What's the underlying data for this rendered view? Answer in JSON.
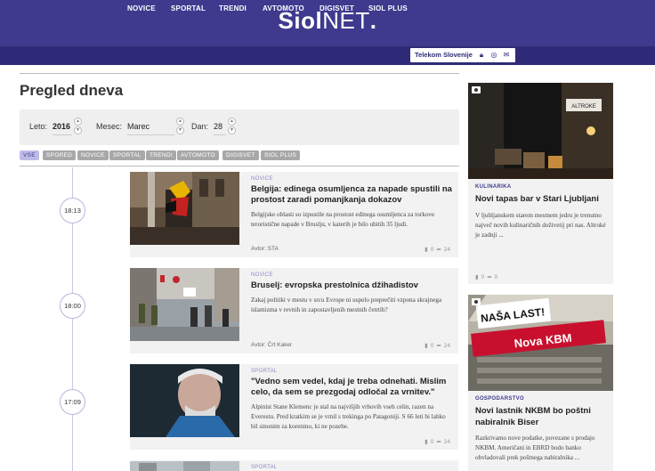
{
  "header": {
    "logo_bold": "Siol",
    "logo_light": "NET",
    "logo_dot": "."
  },
  "nav": {
    "items": [
      "NOVICE",
      "SPORTAL",
      "TRENDI",
      "AVTOMOTO",
      "DIGISVET",
      "SIOL PLUS"
    ],
    "telekom_label": "Telekom Slovenije"
  },
  "page": {
    "title": "Pregled dneva"
  },
  "filters": {
    "year_label": "Leto:",
    "year_value": "2016",
    "month_label": "Mesec:",
    "month_value": "Marec",
    "day_label": "Dan:",
    "day_value": "28"
  },
  "chips": [
    "VSE",
    "SPORED",
    "NOVICE",
    "SPORTAL",
    "TRENDI",
    "AVTOMOTO",
    "DIGISVET",
    "SIOL PLUS"
  ],
  "articles": [
    {
      "time": "18:13",
      "category": "NOVICE",
      "title": "Belgija: edinega osumljenca za napade spustili na prostost zaradi pomanjkanja dokazov",
      "excerpt": "Belgijske oblasti so izpustile na prostost edinega osumljenca za torkove teroristične napade v Bruslju, v katerih je bilo ubitih 35 ljudi.",
      "author": "Avtor: STA",
      "comments": "0",
      "shares": "24"
    },
    {
      "time": "18:00",
      "category": "NOVICE",
      "title": "Bruselj: evropska prestolnica džihadistov",
      "excerpt": "Zakaj politiki v mestu v srcu Evrope ni uspelo preprečiti vzpona skrajnega islamizma v revnih in zapostavljenih mestnih četrtih?",
      "author": "Avtor: Črt Kaker",
      "comments": "0",
      "shares": "24"
    },
    {
      "time": "17:09",
      "category": "SPORTAL",
      "title": "\"Vedno sem vedel, kdaj je treba odnehati. Mislim celo, da sem se prezgodaj odločal za vrnitev.\"",
      "excerpt": "Alpinist Stane Klemenc je stal na najvišjih vrhovih vseh celin, razen na Everestu. Pred kratkim se je vrnil s trekinga po Patagoniji. S 66 leti bi lahko bil sinonim za korenino, ki ne pozebe.",
      "author": "",
      "comments": "0",
      "shares": "24"
    },
    {
      "time": "",
      "category": "SPORTAL",
      "title": "",
      "excerpt": "",
      "author": "",
      "comments": "",
      "shares": ""
    }
  ],
  "sidebar": [
    {
      "category": "KULINARIKA",
      "title": "Novi tapas bar v Stari Ljubljani",
      "excerpt": "V ljubljanskem starem mestnem jedru je trenutno največ novih kulinaričnih doživetij pri nas. Altroké je zadnji ...",
      "comments": "0",
      "shares": "0",
      "sign_text": "ALTROKE"
    },
    {
      "category": "GOSPODARSTVO",
      "title": "Novi lastnik NKBM bo poštni nabiralnik Biser",
      "excerpt": "Razkrivamo nove podatke, povezane s prodajo NKBM. Američani in EBRD bodo banko obvladovali prek poštnega nabiralnika ...",
      "sign_top": "NAŠA LAST!",
      "sign_brand": "Nova KBM"
    }
  ],
  "colors": {
    "brand": "#3f3a8e",
    "nav": "#2f2b78",
    "card_bg": "#f2f2f2",
    "category_text": "#8c8ac4"
  }
}
